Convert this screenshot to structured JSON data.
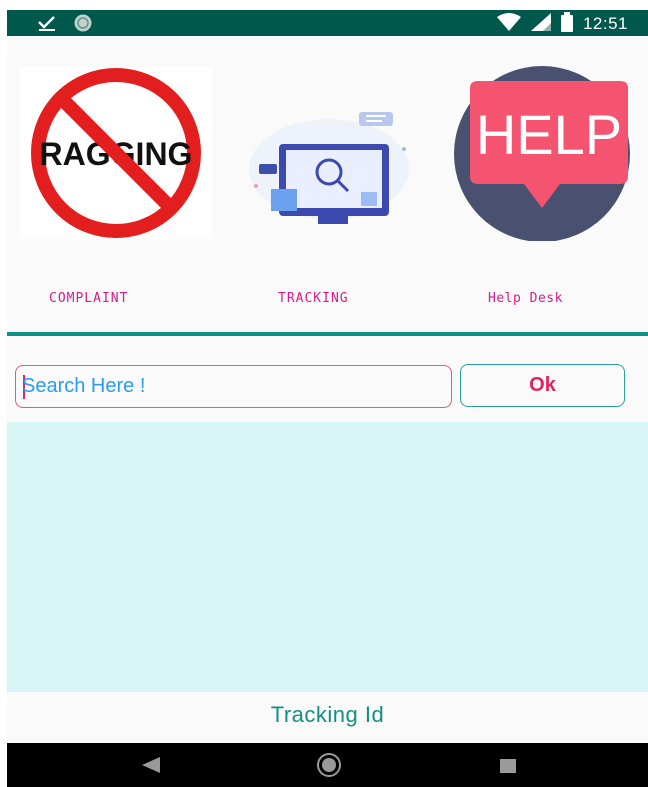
{
  "status_bar": {
    "time": "12:51",
    "icons": [
      "check-download-icon",
      "sync-icon",
      "wifi-icon",
      "signal-icon",
      "battery-icon"
    ]
  },
  "features": [
    {
      "label": "COMPLAINT",
      "image_text": "RAGGING",
      "icon": "no-ragging-icon"
    },
    {
      "label": "TRACKING",
      "icon": "monitor-search-icon"
    },
    {
      "label": "Help Desk",
      "image_text": "HELP",
      "icon": "help-bubble-icon"
    }
  ],
  "search": {
    "placeholder": "Search Here !",
    "value": ""
  },
  "ok_button": {
    "label": "Ok"
  },
  "tracking_label": "Tracking Id",
  "colors": {
    "status_bar": "#00574b",
    "accent_teal": "#0e9288",
    "pink": "#e0245e",
    "results_bg": "#d7f5f4"
  }
}
